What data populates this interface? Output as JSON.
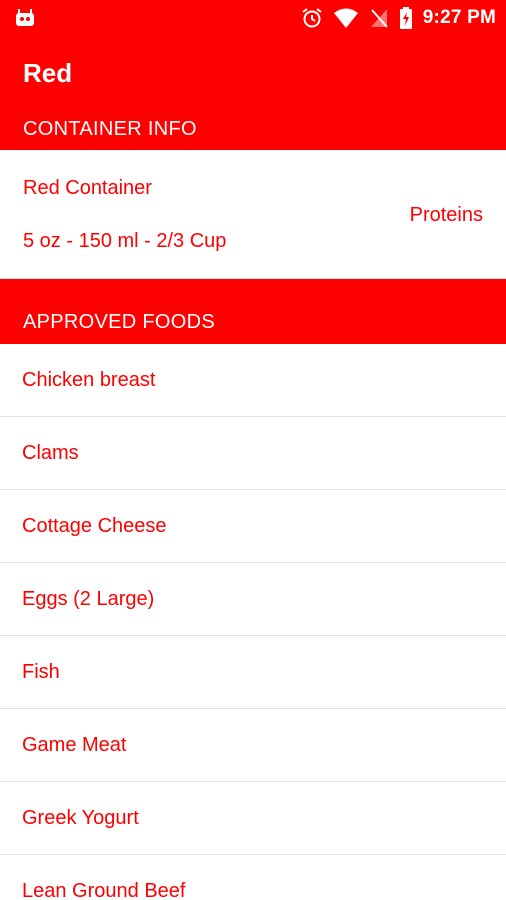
{
  "status_bar": {
    "time": "9:27 PM",
    "icons": [
      "android-debug-icon",
      "alarm-icon",
      "wifi-icon",
      "no-signal-icon",
      "battery-charging-icon"
    ]
  },
  "app_bar": {
    "title": "Red",
    "section_label": "CONTAINER INFO"
  },
  "container_info": {
    "name": "Red Container",
    "size": "5 oz - 150 ml - 2/3 Cup",
    "category": "Proteins"
  },
  "approved_foods": {
    "header": "APPROVED FOODS",
    "items": [
      {
        "label": "Chicken breast"
      },
      {
        "label": "Clams"
      },
      {
        "label": "Cottage Cheese"
      },
      {
        "label": "Eggs (2 Large)"
      },
      {
        "label": "Fish"
      },
      {
        "label": "Game Meat"
      },
      {
        "label": "Greek Yogurt"
      },
      {
        "label": "Lean Ground Beef"
      }
    ]
  },
  "colors": {
    "primary": "#ff0000",
    "background": "#ffffff",
    "text_on_primary": "#ffffff",
    "divider": "#e0e0e0"
  }
}
